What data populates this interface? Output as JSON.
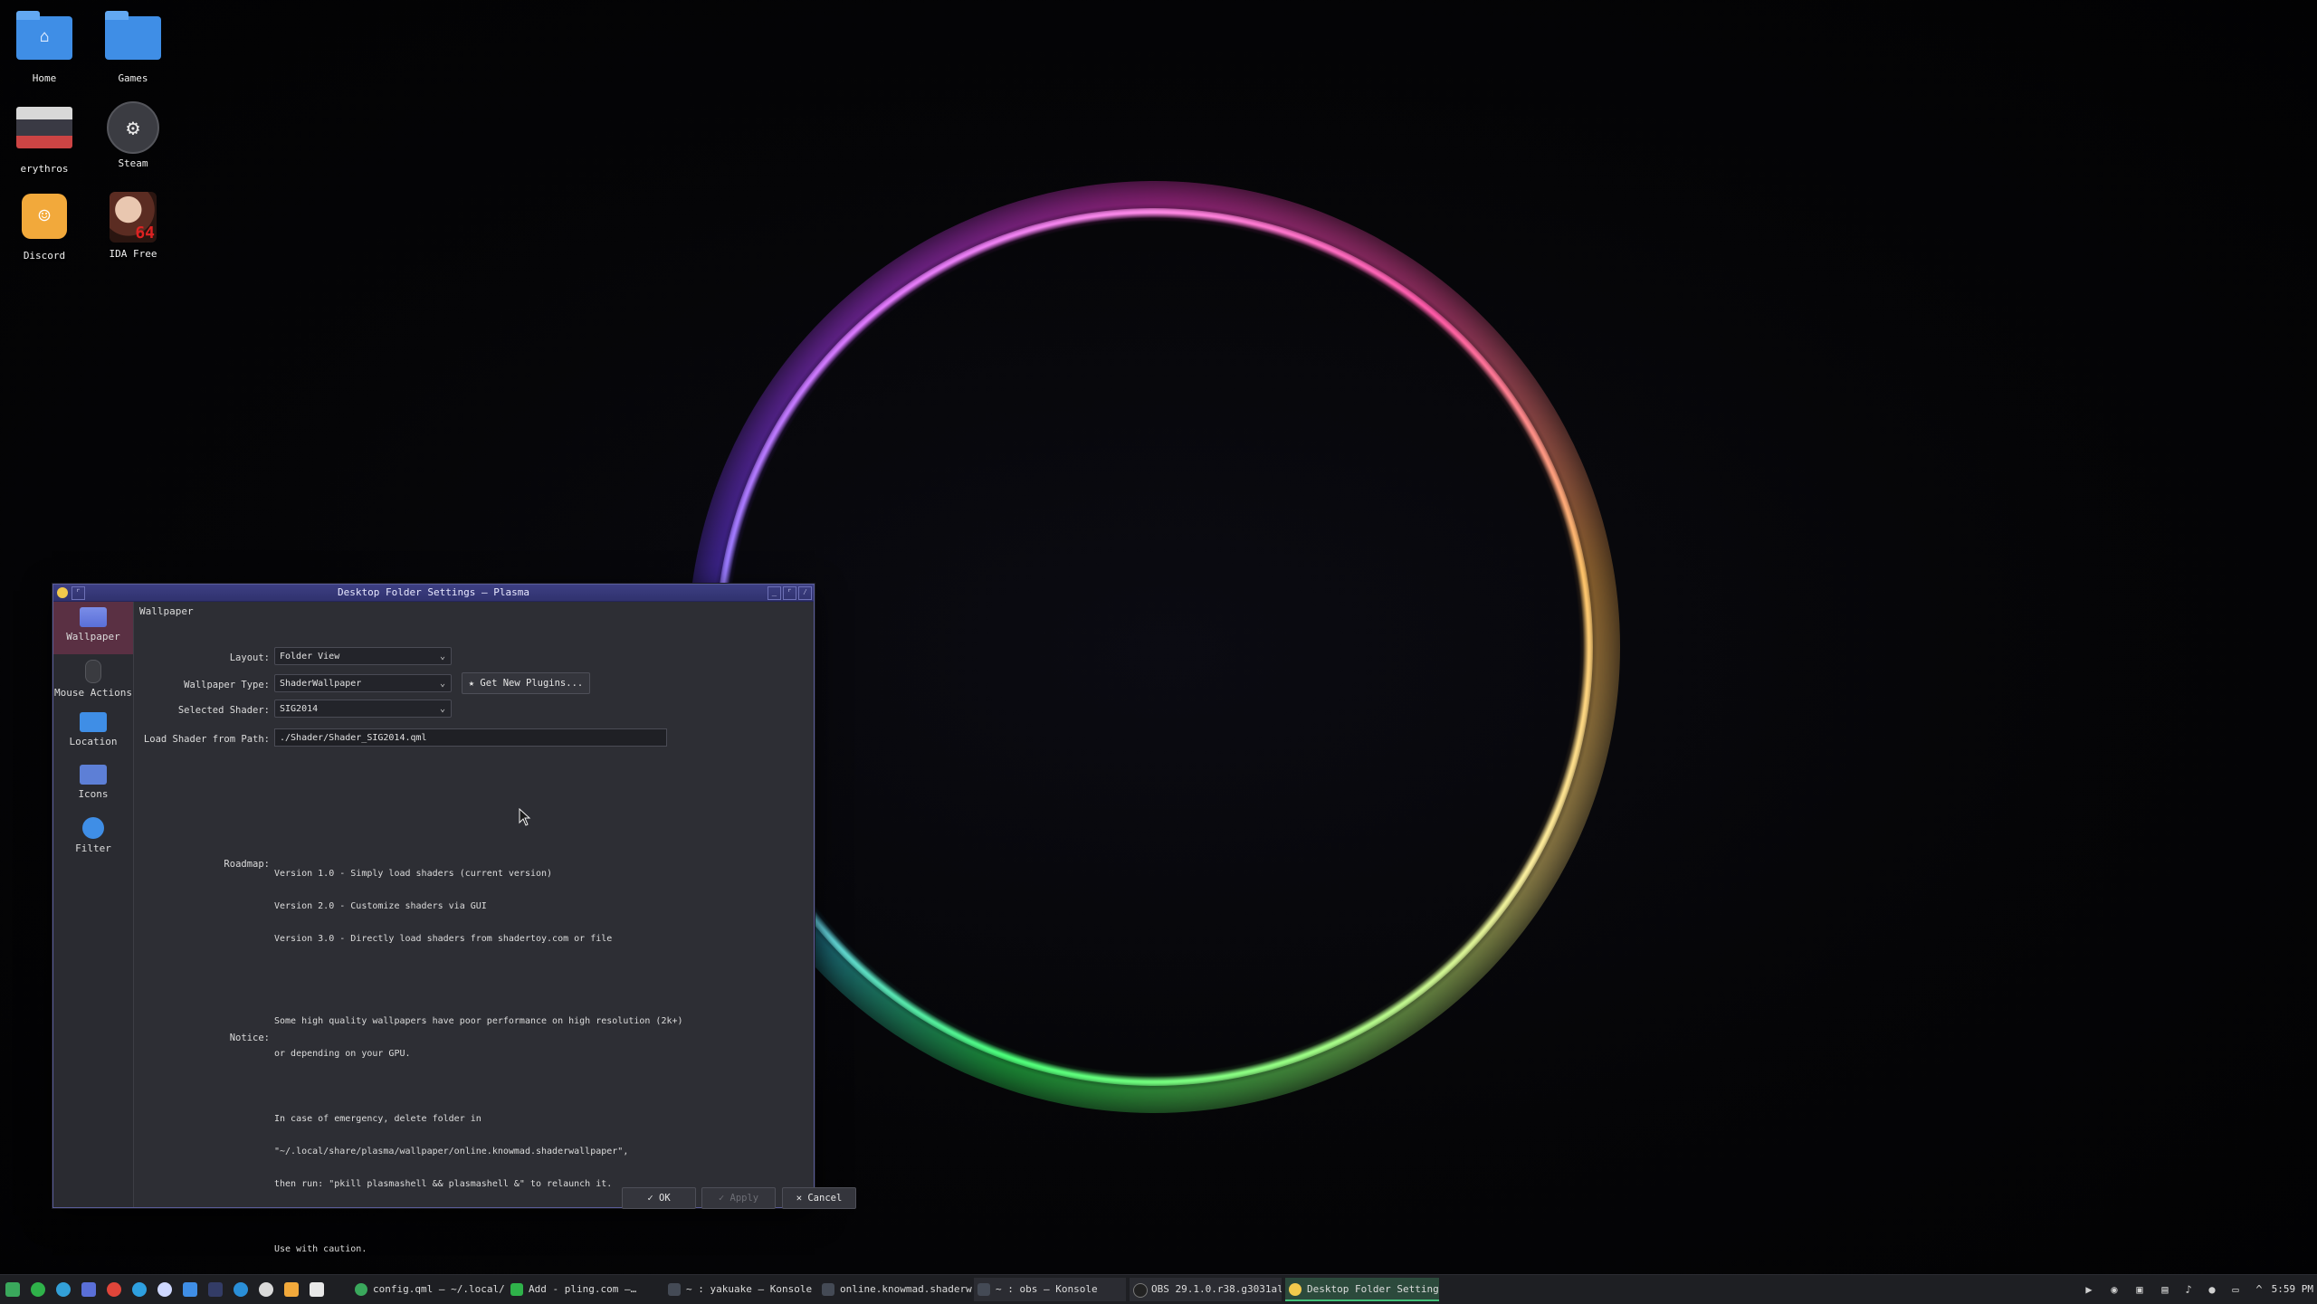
{
  "desktop": {
    "icons": [
      {
        "label": "Home",
        "icon": "home-folder-icon"
      },
      {
        "label": "Games",
        "icon": "folder-icon"
      },
      {
        "label": "erythros",
        "icon": "erythros-icon"
      },
      {
        "label": "Steam",
        "icon": "steam-icon"
      },
      {
        "label": "Discord",
        "icon": "discord-icon"
      },
      {
        "label": "IDA Free",
        "icon": "ida-icon"
      }
    ]
  },
  "window": {
    "title": "Desktop Folder Settings — Plasma",
    "sidebar": [
      {
        "label": "Wallpaper",
        "icon": "wallpaper-icon",
        "active": true
      },
      {
        "label": "Mouse Actions",
        "icon": "mouse-icon"
      },
      {
        "label": "Location",
        "icon": "folder-icon"
      },
      {
        "label": "Icons",
        "icon": "icons-icon"
      },
      {
        "label": "Filter",
        "icon": "filter-icon"
      }
    ],
    "section_title": "Wallpaper",
    "form": {
      "layout_label": "Layout:",
      "layout_value": "Folder View",
      "wallpaper_type_label": "Wallpaper Type:",
      "wallpaper_type_value": "ShaderWallpaper",
      "get_plugins_label": "Get New Plugins...",
      "selected_shader_label": "Selected Shader:",
      "selected_shader_value": "SIG2014",
      "load_path_label": "Load Shader from Path:",
      "load_path_value": "./Shader/Shader_SIG2014.qml",
      "roadmap_label": "Roadmap:",
      "roadmap_lines": [
        "Version 1.0 - Simply load shaders (current version)",
        "Version 2.0 - Customize shaders via GUI",
        "Version 3.0 - Directly load shaders from shadertoy.com or file"
      ],
      "notice_label": "Notice:",
      "notice_lines": [
        "Some high quality wallpapers have poor performance on high resolution (2k+)",
        "or depending on your GPU.",
        "",
        "In case of emergency, delete folder in",
        "\"~/.local/share/plasma/wallpaper/online.knowmad.shaderwallpaper\",",
        "then run: \"pkill plasmashell && plasmashell &\" to relaunch it.",
        "",
        "Use with caution."
      ]
    },
    "buttons": {
      "ok": "OK",
      "apply": "Apply",
      "cancel": "Cancel"
    }
  },
  "taskbar": {
    "tasks": [
      {
        "label": "config.qml — ~/.local/…",
        "icon": "kate-icon",
        "color": "#3aa85c"
      },
      {
        "label": "Add - pling.com —…",
        "icon": "browser-icon",
        "color": "#2fb24a"
      },
      {
        "label": "~ : yakuake — Konsole",
        "icon": "terminal-icon",
        "color": "#444a55"
      },
      {
        "label": "online.knowmad.shaderw…",
        "icon": "terminal-icon",
        "color": "#444a55"
      },
      {
        "label": "~ : obs — Konsole",
        "icon": "terminal-icon",
        "color": "#444a55"
      },
      {
        "label": "OBS 29.1.0.r38.g3031al…",
        "icon": "obs-icon",
        "color": "#333"
      },
      {
        "label": "Desktop Folder Setting…",
        "icon": "plasma-icon",
        "color": "#f2c94c"
      }
    ],
    "clock": "5:59 PM"
  },
  "colors": {
    "window_title_bg": "#3d3f83",
    "sidebar_active": "#5a3043",
    "active_task": "#2c4a3c"
  }
}
